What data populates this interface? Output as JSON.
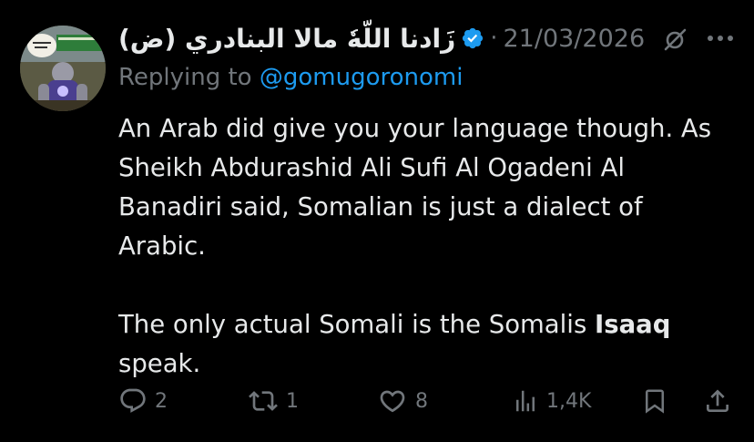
{
  "author": {
    "display_name": "زَادنا اللّهٗ مالا البنادري (ض)",
    "verified": true,
    "date": "21/03/2026"
  },
  "reply": {
    "prefix": "Replying to",
    "handle": "@gomugoronomi"
  },
  "body": {
    "line_1": "An Arab did give you your language though. As",
    "line_2": "Sheikh Abdurashid Ali Sufi Al Ogadeni Al",
    "line_3": "Banadiri said, Somalian is just a dialect of",
    "line_4": "Arabic.",
    "line_5_start": "The only actual Somali is the Somalis ",
    "line_5_bold": "Isaaq",
    "line_6": "speak."
  },
  "actions": {
    "replies": "2",
    "reposts": "1",
    "likes": "8",
    "views": "1,4K"
  },
  "icons": {
    "verified": "verified-badge-icon",
    "grok": "grok-icon",
    "more": "more-icon",
    "reply": "reply-icon",
    "repost": "repost-icon",
    "like": "like-icon",
    "views": "views-icon",
    "bookmark": "bookmark-icon",
    "share": "share-icon"
  },
  "colors": {
    "background": "#000000",
    "text": "#e7e9ea",
    "muted": "#71767b",
    "accent": "#1d9bf0"
  }
}
